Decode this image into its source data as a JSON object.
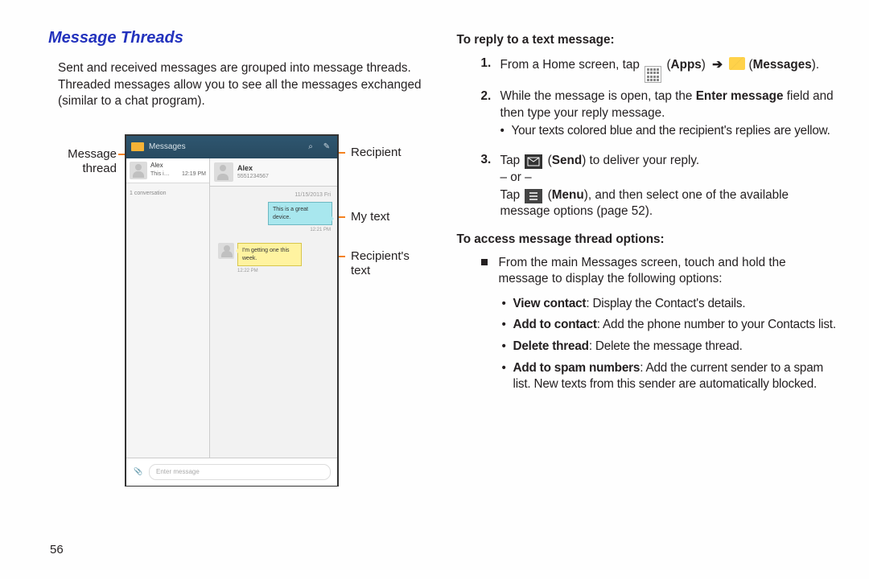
{
  "page_number": "56",
  "left": {
    "heading": "Message Threads",
    "intro": "Sent and received messages are grouped into message threads. Threaded messages allow you to see all the messages exchanged (similar to a chat program).",
    "figure": {
      "app_title": "Messages",
      "thread_name": "Alex",
      "thread_preview": "This i…",
      "thread_time": "12:19 PM",
      "conv_count": "1 conversation",
      "chat_name": "Alex",
      "chat_phone": "5551234567",
      "chat_date": "11/15/2013 Fri",
      "blue_bubble": "This is a great device.",
      "blue_time": "12:21 PM",
      "yellow_bubble": "I'm getting one this week.",
      "yellow_time": "12:22 PM",
      "enter_placeholder": "Enter message"
    },
    "callouts": {
      "message_thread": "Message thread",
      "recipient": "Recipient",
      "my_text": "My text",
      "recipient_text": "Recipient's text"
    }
  },
  "right": {
    "reply_head": "To reply to a text message:",
    "step1_a": "From a Home screen, tap ",
    "step1_b": " (",
    "step1_apps": "Apps",
    "step1_c": ") ",
    "step1_d": " (",
    "step1_msgs": "Messages",
    "step1_e": ").",
    "step2": "While the message is open, tap the ",
    "step2_bold": "Enter message",
    "step2_b": " field and then type your reply message.",
    "step2_sub": "Your texts colored blue and the recipient's replies are yellow.",
    "step3_a": "Tap ",
    "step3_b": " (",
    "step3_send": "Send",
    "step3_c": ") to deliver your reply.",
    "or": "– or –",
    "step3_d": "Tap ",
    "step3_e": " (",
    "step3_menu": "Menu",
    "step3_f": "), and then select one of the available message options (page 52).",
    "access_head": "To access message thread options:",
    "access_intro": "From the main Messages screen, touch and hold the message to display the following options:",
    "opts": {
      "view_b": "View contact",
      "view_t": ": Display the Contact's details.",
      "add_b": "Add to contact",
      "add_t": ": Add the phone number to your Contacts list.",
      "del_b": "Delete thread",
      "del_t": ": Delete the message thread.",
      "spam_b": "Add to spam numbers",
      "spam_t": ": Add the current sender to a spam list. New texts from this sender are automatically blocked."
    }
  }
}
